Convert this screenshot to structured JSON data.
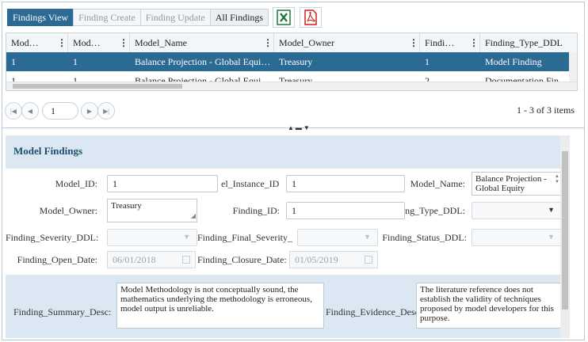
{
  "toolbar": {
    "tabs": [
      "Findings View",
      "Finding Create",
      "Finding Update",
      "All Findings"
    ],
    "excel_icon": "excel-icon",
    "pdf_icon": "pdf-icon"
  },
  "grid": {
    "columns": [
      "Mod…",
      "Mod…",
      "Model_Name",
      "Model_Owner",
      "Findi…",
      "Finding_Type_DDL"
    ],
    "rows": [
      [
        "1",
        "1",
        "Balance Projection - Global Equi…",
        "Treasury",
        "1",
        "Model Finding"
      ],
      [
        "1",
        "1",
        "Balance Projection - Global Equi…",
        "Treasury",
        "2",
        "Documentation Finding"
      ]
    ]
  },
  "pager": {
    "page": "1",
    "info": "1 - 3 of 3 items"
  },
  "form": {
    "title": "Model Findings",
    "model_id_label": "Model_ID:",
    "model_id_value": "1",
    "model_instance_id_label": "el_Instance_ID:",
    "model_instance_id_value": "1",
    "model_name_label": "Model_Name:",
    "model_name_value": "Balance Projection - Global Equity",
    "model_owner_label": "Model_Owner:",
    "model_owner_value": "Treasury",
    "finding_id_label": "Finding_ID:",
    "finding_id_value": "1",
    "finding_type_label": "ng_Type_DDL:",
    "finding_severity_label": "Finding_Severity_DDL:",
    "finding_final_severity_label": "Finding_Final_Severity_",
    "finding_status_label": "Finding_Status_DDL:",
    "finding_open_date_label": "Finding_Open_Date:",
    "finding_open_date_value": "06/01/2018",
    "finding_closure_date_label": "Finding_Closure_Date:",
    "finding_closure_date_value": "01/05/2019",
    "finding_summary_label": "Finding_Summary_Desc:",
    "finding_summary_value": "Model Methodology is not conceptually sound, the mathematics underlying the methodology is erroneous, model output is unreliable.",
    "finding_evidence_label": "Finding_Evidence_Desc:",
    "finding_evidence_value": "The literature reference does not establish the validity of techniques proposed by model developers for this purpose."
  }
}
